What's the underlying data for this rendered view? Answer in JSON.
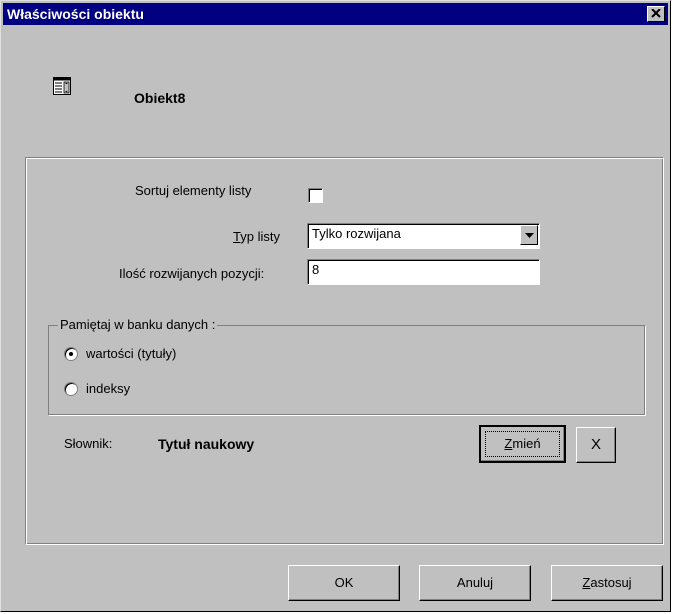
{
  "window": {
    "title": "Właściwości obiektu",
    "close_icon": "close-icon"
  },
  "object": {
    "icon": "list-object-icon",
    "name": "Obiekt8"
  },
  "form": {
    "sort_label": "Sortuj elementy listy",
    "sort_checked": false,
    "list_type_label_mnemonic": "T",
    "list_type_label_rest": "yp listy",
    "list_type_value": "Tylko rozwijana",
    "dropdown_count_label": "Ilość rozwijanych pozycji:",
    "dropdown_count_value": "8"
  },
  "store_group": {
    "title": "Pamiętaj w banku danych :",
    "options": [
      {
        "label": "wartości (tytuły)",
        "selected": true
      },
      {
        "label": "indeksy",
        "selected": false
      }
    ]
  },
  "dictionary": {
    "label": "Słownik:",
    "value": "Tytuł naukowy",
    "change_mnemonic": "Z",
    "change_rest": "mień",
    "clear_label": "X"
  },
  "footer": {
    "ok_label": "OK",
    "cancel_label": "Anuluj",
    "apply_mnemonic": "Z",
    "apply_rest": "astosuj"
  },
  "colors": {
    "face": "#c0c0c0",
    "titlebar": "#000080",
    "titlebar_text": "#ffffff"
  }
}
